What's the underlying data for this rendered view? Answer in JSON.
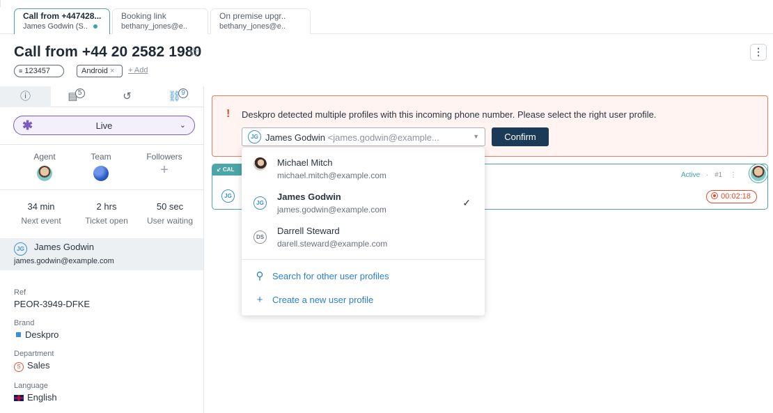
{
  "tabs": [
    {
      "title": "Call from +447428...",
      "subtitle": "James Godwin (S..",
      "active": true
    },
    {
      "title": "Booking link",
      "subtitle": "bethany_jones@e..",
      "active": false
    },
    {
      "title": "On premise upgr..",
      "subtitle": "bethany_jones@e..",
      "active": false
    }
  ],
  "header": {
    "title": "Call from +44 20 2582 1980",
    "star_icon": "☆",
    "more_icon": "⋮",
    "ticket_id": "123457",
    "tag": "Android",
    "tag_remove": "×",
    "add_label": "+ Add"
  },
  "sidebar": {
    "tab_badges": {
      "notes": "5",
      "linked": "9"
    },
    "status": {
      "label": "Live",
      "icon": "✱",
      "color": "#7b5bbd"
    },
    "people": {
      "agent_label": "Agent",
      "team_label": "Team",
      "followers_label": "Followers",
      "followers_add": "+"
    },
    "stats": [
      {
        "value": "34 min",
        "label": "Next event"
      },
      {
        "value": "2 hrs",
        "label": "Ticket open"
      },
      {
        "value": "50 sec",
        "label": "User waiting"
      }
    ],
    "user": {
      "initials": "JG",
      "name": "James Godwin",
      "email": "james.godwin@example.com"
    },
    "fields": {
      "ref_label": "Ref",
      "ref_value": "PEOR-3949-DFKE",
      "brand_label": "Brand",
      "brand_value": "Deskpro",
      "department_label": "Department",
      "department_icon": "S",
      "department_value": "Sales",
      "language_label": "Language",
      "language_value": "English"
    }
  },
  "alert": {
    "icon": "!",
    "message": "Deskpro detected multiple profiles with this incoming phone number. Please select the right user profile.",
    "selected_initials": "JG",
    "selected_name": "James Godwin",
    "selected_email": "<james.godwin@example...",
    "confirm_label": "Confirm"
  },
  "call_card": {
    "tag": "CAL",
    "status": "Active",
    "separator": "·",
    "number": "#1",
    "more": "⋮",
    "initials": "JG",
    "timer": "00:02:18"
  },
  "dropdown": {
    "profiles": [
      {
        "name": "Michael Mitch",
        "email": "michael.mitch@example.com",
        "initials": "",
        "selected": false
      },
      {
        "name": "James Godwin",
        "email": "james.godwin@example.com",
        "initials": "JG",
        "selected": true
      },
      {
        "name": "Darrell Steward",
        "email": "darell.steward@example.com",
        "initials": "DS",
        "selected": false
      }
    ],
    "search_label": "Search for other user profiles",
    "create_label": "Create a new user profile"
  },
  "colors": {
    "accent": "#4aa6a8",
    "primary_button": "#1b3a57",
    "alert_border": "#e97a62",
    "link": "#2a7fcf",
    "status": "#7b5bbd"
  }
}
